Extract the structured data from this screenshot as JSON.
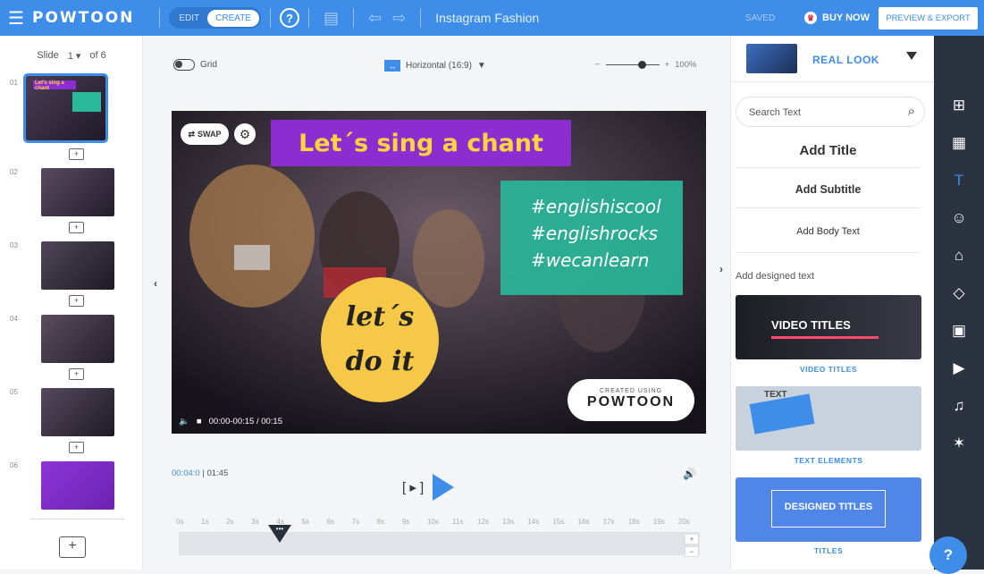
{
  "app": {
    "logo": "POWTOON",
    "mode_edit": "EDIT",
    "mode_create": "CREATE",
    "project_title": "Instagram Fashion",
    "saved": "SAVED",
    "buy_now": "BUY NOW",
    "export": "PREVIEW & EXPORT"
  },
  "slides": {
    "label": "Slide",
    "current": "1",
    "of": "of 6",
    "numbers": [
      "01",
      "02",
      "03",
      "04",
      "05",
      "06"
    ],
    "thumb1_title": "Let's sing a chant"
  },
  "canvas": {
    "grid_label": "Grid",
    "orientation": "Horizontal (16:9)",
    "zoom": "100%",
    "headline": "Let´s sing a chant",
    "hashtags": [
      "#englishiscool",
      "#englishrocks",
      "#wecanlearn"
    ],
    "circle_line1": "let´s",
    "circle_line2": "do it",
    "swap": "SWAP",
    "created_using": "CREATED USING",
    "brand": "POWTOON",
    "time_range": "00:00-00:15 / 00:15"
  },
  "timeline": {
    "current": "00:04:0",
    "total": "01:45",
    "ticks": [
      "0s",
      "1s",
      "2s",
      "3s",
      "4s",
      "5s",
      "6s",
      "7s",
      "8s",
      "9s",
      "10s",
      "11s",
      "12s",
      "13s",
      "14s",
      "15s",
      "16s",
      "17s",
      "18s",
      "19s",
      "20s"
    ],
    "playhead_seconds": 4
  },
  "panel": {
    "style_name": "REAL LOOK",
    "search_placeholder": "Search Text",
    "add_title": "Add Title",
    "add_subtitle": "Add Subtitle",
    "add_body": "Add Body Text",
    "designed_text": "Add designed text",
    "cards": [
      {
        "caption": "VIDEO TITLES",
        "inner": "VIDEO TITLES"
      },
      {
        "caption": "TEXT ELEMENTS",
        "inner": "TEXT"
      },
      {
        "caption": "TITLES",
        "inner": "DESIGNED TITLES"
      }
    ]
  },
  "colors": {
    "accent": "#3d8de9",
    "sidebar": "#2b3240",
    "purple": "#8c2dd1",
    "teal": "#29b89a",
    "yellow": "#f6c848"
  }
}
